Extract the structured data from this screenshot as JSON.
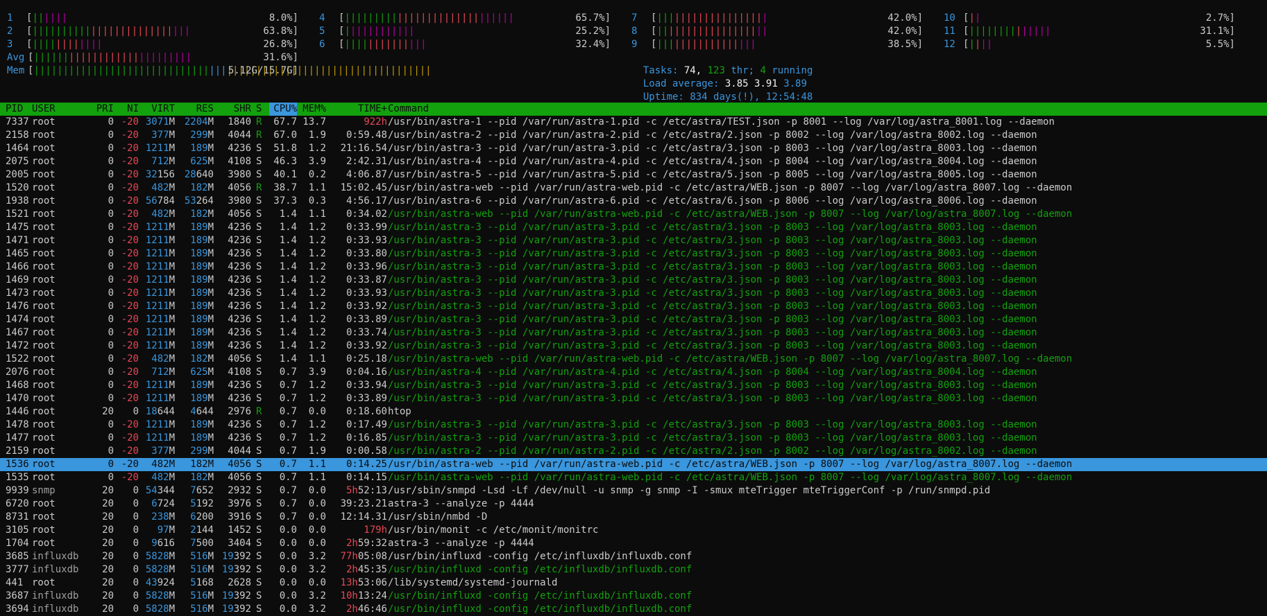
{
  "meters": {
    "left": [
      {
        "label": "1",
        "pct": "8.0%"
      },
      {
        "label": "2",
        "pct": "63.8%"
      },
      {
        "label": "3",
        "pct": "26.8%"
      },
      {
        "label": "Avg",
        "pct": "31.6%"
      },
      {
        "label": "Mem",
        "pct": "5.12G/15.7G"
      }
    ],
    "mid": [
      {
        "label": "4",
        "pct": "65.7%"
      },
      {
        "label": "5",
        "pct": "25.2%"
      },
      {
        "label": "6",
        "pct": "32.4%"
      }
    ],
    "right": [
      {
        "label": "7",
        "pct": "42.0%"
      },
      {
        "label": "8",
        "pct": "42.0%"
      },
      {
        "label": "9",
        "pct": "38.5%"
      }
    ],
    "far": [
      {
        "label": "10",
        "pct": "2.7%"
      },
      {
        "label": "11",
        "pct": "31.1%"
      },
      {
        "label": "12",
        "pct": "5.5%"
      }
    ]
  },
  "tasks": {
    "label": "Tasks:",
    "count": "74,",
    "thr": "123",
    "thr_label": "thr;",
    "running": "4",
    "running_label": "running"
  },
  "load": {
    "label": "Load average:",
    "v1": "3.85",
    "v2": "3.91",
    "v3": "3.89"
  },
  "uptime": {
    "label": "Uptime:",
    "value": "834 days(!), 12:54:48"
  },
  "columns": [
    "PID",
    "USER",
    "PRI",
    "NI",
    "VIRT",
    "RES",
    "SHR",
    "S",
    "CPU%",
    "MEM%",
    "TIME+",
    "Command"
  ],
  "colors": {
    "green": "#13a10e",
    "blue": "#3a96dd",
    "red": "#e74856",
    "magenta": "#b4009e",
    "yellow": "#c19c00"
  },
  "processes": [
    {
      "pid": "7337",
      "user": "root",
      "pri": "0",
      "ni": "-20",
      "virt": "3071M",
      "res": "2204M",
      "shr": "1840",
      "s": "R",
      "cpu": "67.7",
      "mem": "13.7",
      "time": "922h",
      "cmd": "/usr/bin/astra-1 --pid /var/run/astra-1.pid -c /etc/astra/TEST.json -p 8001 --log /var/log/astra_8001.log --daemon",
      "thread": false
    },
    {
      "pid": "2158",
      "user": "root",
      "pri": "0",
      "ni": "-20",
      "virt": "377M",
      "res": "299M",
      "shr": "4044",
      "s": "R",
      "cpu": "67.0",
      "mem": "1.9",
      "time": "0:59.48",
      "cmd": "/usr/bin/astra-2 --pid /var/run/astra-2.pid -c /etc/astra/2.json -p 8002 --log /var/log/astra_8002.log --daemon",
      "thread": false
    },
    {
      "pid": "1464",
      "user": "root",
      "pri": "0",
      "ni": "-20",
      "virt": "1211M",
      "res": "189M",
      "shr": "4236",
      "s": "S",
      "cpu": "51.8",
      "mem": "1.2",
      "time": "21:16.54",
      "cmd": "/usr/bin/astra-3 --pid /var/run/astra-3.pid -c /etc/astra/3.json -p 8003 --log /var/log/astra_8003.log --daemon",
      "thread": false
    },
    {
      "pid": "2075",
      "user": "root",
      "pri": "0",
      "ni": "-20",
      "virt": "712M",
      "res": "625M",
      "shr": "4108",
      "s": "S",
      "cpu": "46.3",
      "mem": "3.9",
      "time": "2:42.31",
      "cmd": "/usr/bin/astra-4 --pid /var/run/astra-4.pid -c /etc/astra/4.json -p 8004 --log /var/log/astra_8004.log --daemon",
      "thread": false
    },
    {
      "pid": "2005",
      "user": "root",
      "pri": "0",
      "ni": "-20",
      "virt": "32156",
      "res": "28640",
      "shr": "3980",
      "s": "S",
      "cpu": "40.1",
      "mem": "0.2",
      "time": "4:06.87",
      "cmd": "/usr/bin/astra-5 --pid /var/run/astra-5.pid -c /etc/astra/5.json -p 8005 --log /var/log/astra_8005.log --daemon",
      "thread": false
    },
    {
      "pid": "1520",
      "user": "root",
      "pri": "0",
      "ni": "-20",
      "virt": "482M",
      "res": "182M",
      "shr": "4056",
      "s": "R",
      "cpu": "38.7",
      "mem": "1.1",
      "time": "15:02.45",
      "cmd": "/usr/bin/astra-web --pid /var/run/astra-web.pid -c /etc/astra/WEB.json -p 8007 --log /var/log/astra_8007.log --daemon",
      "thread": false
    },
    {
      "pid": "1938",
      "user": "root",
      "pri": "0",
      "ni": "-20",
      "virt": "56784",
      "res": "53264",
      "shr": "3980",
      "s": "S",
      "cpu": "37.3",
      "mem": "0.3",
      "time": "4:56.17",
      "cmd": "/usr/bin/astra-6 --pid /var/run/astra-6.pid -c /etc/astra/6.json -p 8006 --log /var/log/astra_8006.log --daemon",
      "thread": false
    },
    {
      "pid": "1521",
      "user": "root",
      "pri": "0",
      "ni": "-20",
      "virt": "482M",
      "res": "182M",
      "shr": "4056",
      "s": "S",
      "cpu": "1.4",
      "mem": "1.1",
      "time": "0:34.02",
      "cmd": "/usr/bin/astra-web --pid /var/run/astra-web.pid -c /etc/astra/WEB.json -p 8007 --log /var/log/astra_8007.log --daemon",
      "thread": true
    },
    {
      "pid": "1475",
      "user": "root",
      "pri": "0",
      "ni": "-20",
      "virt": "1211M",
      "res": "189M",
      "shr": "4236",
      "s": "S",
      "cpu": "1.4",
      "mem": "1.2",
      "time": "0:33.99",
      "cmd": "/usr/bin/astra-3 --pid /var/run/astra-3.pid -c /etc/astra/3.json -p 8003 --log /var/log/astra_8003.log --daemon",
      "thread": true
    },
    {
      "pid": "1471",
      "user": "root",
      "pri": "0",
      "ni": "-20",
      "virt": "1211M",
      "res": "189M",
      "shr": "4236",
      "s": "S",
      "cpu": "1.4",
      "mem": "1.2",
      "time": "0:33.93",
      "cmd": "/usr/bin/astra-3 --pid /var/run/astra-3.pid -c /etc/astra/3.json -p 8003 --log /var/log/astra_8003.log --daemon",
      "thread": true
    },
    {
      "pid": "1465",
      "user": "root",
      "pri": "0",
      "ni": "-20",
      "virt": "1211M",
      "res": "189M",
      "shr": "4236",
      "s": "S",
      "cpu": "1.4",
      "mem": "1.2",
      "time": "0:33.80",
      "cmd": "/usr/bin/astra-3 --pid /var/run/astra-3.pid -c /etc/astra/3.json -p 8003 --log /var/log/astra_8003.log --daemon",
      "thread": true
    },
    {
      "pid": "1466",
      "user": "root",
      "pri": "0",
      "ni": "-20",
      "virt": "1211M",
      "res": "189M",
      "shr": "4236",
      "s": "S",
      "cpu": "1.4",
      "mem": "1.2",
      "time": "0:33.96",
      "cmd": "/usr/bin/astra-3 --pid /var/run/astra-3.pid -c /etc/astra/3.json -p 8003 --log /var/log/astra_8003.log --daemon",
      "thread": true
    },
    {
      "pid": "1469",
      "user": "root",
      "pri": "0",
      "ni": "-20",
      "virt": "1211M",
      "res": "189M",
      "shr": "4236",
      "s": "S",
      "cpu": "1.4",
      "mem": "1.2",
      "time": "0:33.87",
      "cmd": "/usr/bin/astra-3 --pid /var/run/astra-3.pid -c /etc/astra/3.json -p 8003 --log /var/log/astra_8003.log --daemon",
      "thread": true
    },
    {
      "pid": "1473",
      "user": "root",
      "pri": "0",
      "ni": "-20",
      "virt": "1211M",
      "res": "189M",
      "shr": "4236",
      "s": "S",
      "cpu": "1.4",
      "mem": "1.2",
      "time": "0:33.93",
      "cmd": "/usr/bin/astra-3 --pid /var/run/astra-3.pid -c /etc/astra/3.json -p 8003 --log /var/log/astra_8003.log --daemon",
      "thread": true
    },
    {
      "pid": "1476",
      "user": "root",
      "pri": "0",
      "ni": "-20",
      "virt": "1211M",
      "res": "189M",
      "shr": "4236",
      "s": "S",
      "cpu": "1.4",
      "mem": "1.2",
      "time": "0:33.92",
      "cmd": "/usr/bin/astra-3 --pid /var/run/astra-3.pid -c /etc/astra/3.json -p 8003 --log /var/log/astra_8003.log --daemon",
      "thread": true
    },
    {
      "pid": "1474",
      "user": "root",
      "pri": "0",
      "ni": "-20",
      "virt": "1211M",
      "res": "189M",
      "shr": "4236",
      "s": "S",
      "cpu": "1.4",
      "mem": "1.2",
      "time": "0:33.89",
      "cmd": "/usr/bin/astra-3 --pid /var/run/astra-3.pid -c /etc/astra/3.json -p 8003 --log /var/log/astra_8003.log --daemon",
      "thread": true
    },
    {
      "pid": "1467",
      "user": "root",
      "pri": "0",
      "ni": "-20",
      "virt": "1211M",
      "res": "189M",
      "shr": "4236",
      "s": "S",
      "cpu": "1.4",
      "mem": "1.2",
      "time": "0:33.74",
      "cmd": "/usr/bin/astra-3 --pid /var/run/astra-3.pid -c /etc/astra/3.json -p 8003 --log /var/log/astra_8003.log --daemon",
      "thread": true
    },
    {
      "pid": "1472",
      "user": "root",
      "pri": "0",
      "ni": "-20",
      "virt": "1211M",
      "res": "189M",
      "shr": "4236",
      "s": "S",
      "cpu": "1.4",
      "mem": "1.2",
      "time": "0:33.92",
      "cmd": "/usr/bin/astra-3 --pid /var/run/astra-3.pid -c /etc/astra/3.json -p 8003 --log /var/log/astra_8003.log --daemon",
      "thread": true
    },
    {
      "pid": "1522",
      "user": "root",
      "pri": "0",
      "ni": "-20",
      "virt": "482M",
      "res": "182M",
      "shr": "4056",
      "s": "S",
      "cpu": "1.4",
      "mem": "1.1",
      "time": "0:25.18",
      "cmd": "/usr/bin/astra-web --pid /var/run/astra-web.pid -c /etc/astra/WEB.json -p 8007 --log /var/log/astra_8007.log --daemon",
      "thread": true
    },
    {
      "pid": "2076",
      "user": "root",
      "pri": "0",
      "ni": "-20",
      "virt": "712M",
      "res": "625M",
      "shr": "4108",
      "s": "S",
      "cpu": "0.7",
      "mem": "3.9",
      "time": "0:04.16",
      "cmd": "/usr/bin/astra-4 --pid /var/run/astra-4.pid -c /etc/astra/4.json -p 8004 --log /var/log/astra_8004.log --daemon",
      "thread": true
    },
    {
      "pid": "1468",
      "user": "root",
      "pri": "0",
      "ni": "-20",
      "virt": "1211M",
      "res": "189M",
      "shr": "4236",
      "s": "S",
      "cpu": "0.7",
      "mem": "1.2",
      "time": "0:33.94",
      "cmd": "/usr/bin/astra-3 --pid /var/run/astra-3.pid -c /etc/astra/3.json -p 8003 --log /var/log/astra_8003.log --daemon",
      "thread": true
    },
    {
      "pid": "1470",
      "user": "root",
      "pri": "0",
      "ni": "-20",
      "virt": "1211M",
      "res": "189M",
      "shr": "4236",
      "s": "S",
      "cpu": "0.7",
      "mem": "1.2",
      "time": "0:33.89",
      "cmd": "/usr/bin/astra-3 --pid /var/run/astra-3.pid -c /etc/astra/3.json -p 8003 --log /var/log/astra_8003.log --daemon",
      "thread": true
    },
    {
      "pid": "1446",
      "user": "root",
      "pri": "20",
      "ni": "0",
      "virt": "18644",
      "res": "4644",
      "shr": "2976",
      "s": "R",
      "cpu": "0.7",
      "mem": "0.0",
      "time": "0:18.60",
      "cmd": "htop",
      "thread": false
    },
    {
      "pid": "1478",
      "user": "root",
      "pri": "0",
      "ni": "-20",
      "virt": "1211M",
      "res": "189M",
      "shr": "4236",
      "s": "S",
      "cpu": "0.7",
      "mem": "1.2",
      "time": "0:17.49",
      "cmd": "/usr/bin/astra-3 --pid /var/run/astra-3.pid -c /etc/astra/3.json -p 8003 --log /var/log/astra_8003.log --daemon",
      "thread": true
    },
    {
      "pid": "1477",
      "user": "root",
      "pri": "0",
      "ni": "-20",
      "virt": "1211M",
      "res": "189M",
      "shr": "4236",
      "s": "S",
      "cpu": "0.7",
      "mem": "1.2",
      "time": "0:16.85",
      "cmd": "/usr/bin/astra-3 --pid /var/run/astra-3.pid -c /etc/astra/3.json -p 8003 --log /var/log/astra_8003.log --daemon",
      "thread": true
    },
    {
      "pid": "2159",
      "user": "root",
      "pri": "0",
      "ni": "-20",
      "virt": "377M",
      "res": "299M",
      "shr": "4044",
      "s": "S",
      "cpu": "0.7",
      "mem": "1.9",
      "time": "0:00.58",
      "cmd": "/usr/bin/astra-2 --pid /var/run/astra-2.pid -c /etc/astra/2.json -p 8002 --log /var/log/astra_8002.log --daemon",
      "thread": true
    },
    {
      "pid": "1536",
      "user": "root",
      "pri": "0",
      "ni": "-20",
      "virt": "482M",
      "res": "182M",
      "shr": "4056",
      "s": "S",
      "cpu": "0.7",
      "mem": "1.1",
      "time": "0:14.25",
      "cmd": "/usr/bin/astra-web --pid /var/run/astra-web.pid -c /etc/astra/WEB.json -p 8007 --log /var/log/astra_8007.log --daemon",
      "thread": true,
      "selected": true
    },
    {
      "pid": "1535",
      "user": "root",
      "pri": "0",
      "ni": "-20",
      "virt": "482M",
      "res": "182M",
      "shr": "4056",
      "s": "S",
      "cpu": "0.7",
      "mem": "1.1",
      "time": "0:14.15",
      "cmd": "/usr/bin/astra-web --pid /var/run/astra-web.pid -c /etc/astra/WEB.json -p 8007 --log /var/log/astra_8007.log --daemon",
      "thread": true
    },
    {
      "pid": "9939",
      "user": "snmp",
      "pri": "20",
      "ni": "0",
      "virt": "54344",
      "res": "7652",
      "shr": "2932",
      "s": "S",
      "cpu": "0.7",
      "mem": "0.0",
      "time": "5h52:13",
      "cmd": "/usr/sbin/snmpd -Lsd -Lf /dev/null -u snmp -g snmp -I -smux mteTrigger mteTriggerConf -p /run/snmpd.pid",
      "thread": false
    },
    {
      "pid": "6720",
      "user": "root",
      "pri": "20",
      "ni": "0",
      "virt": "6724",
      "res": "5192",
      "shr": "3976",
      "s": "S",
      "cpu": "0.7",
      "mem": "0.0",
      "time": "39:23.21",
      "cmd": "astra-3 --analyze -p 4444",
      "thread": false
    },
    {
      "pid": "8731",
      "user": "root",
      "pri": "20",
      "ni": "0",
      "virt": "238M",
      "res": "6200",
      "shr": "3916",
      "s": "S",
      "cpu": "0.7",
      "mem": "0.0",
      "time": "12:14.31",
      "cmd": "/usr/sbin/nmbd -D",
      "thread": false
    },
    {
      "pid": "3105",
      "user": "root",
      "pri": "20",
      "ni": "0",
      "virt": "97M",
      "res": "2144",
      "shr": "1452",
      "s": "S",
      "cpu": "0.0",
      "mem": "0.0",
      "time": "179h",
      "cmd": "/usr/bin/monit -c /etc/monit/monitrc",
      "thread": false
    },
    {
      "pid": "1704",
      "user": "root",
      "pri": "20",
      "ni": "0",
      "virt": "9616",
      "res": "7500",
      "shr": "3404",
      "s": "S",
      "cpu": "0.0",
      "mem": "0.0",
      "time": "2h59:32",
      "cmd": "astra-3 --analyze -p 4444",
      "thread": false
    },
    {
      "pid": "3685",
      "user": "influxdb",
      "pri": "20",
      "ni": "0",
      "virt": "5828M",
      "res": "516M",
      "shr": "19392",
      "s": "S",
      "cpu": "0.0",
      "mem": "3.2",
      "time": "77h05:08",
      "cmd": "/usr/bin/influxd -config /etc/influxdb/influxdb.conf",
      "thread": false
    },
    {
      "pid": "3777",
      "user": "influxdb",
      "pri": "20",
      "ni": "0",
      "virt": "5828M",
      "res": "516M",
      "shr": "19392",
      "s": "S",
      "cpu": "0.0",
      "mem": "3.2",
      "time": "2h45:35",
      "cmd": "/usr/bin/influxd -config /etc/influxdb/influxdb.conf",
      "thread": true
    },
    {
      "pid": "441",
      "user": "root",
      "pri": "20",
      "ni": "0",
      "virt": "43924",
      "res": "5168",
      "shr": "2628",
      "s": "S",
      "cpu": "0.0",
      "mem": "0.0",
      "time": "13h53:06",
      "cmd": "/lib/systemd/systemd-journald",
      "thread": false
    },
    {
      "pid": "3687",
      "user": "influxdb",
      "pri": "20",
      "ni": "0",
      "virt": "5828M",
      "res": "516M",
      "shr": "19392",
      "s": "S",
      "cpu": "0.0",
      "mem": "3.2",
      "time": "10h13:24",
      "cmd": "/usr/bin/influxd -config /etc/influxdb/influxdb.conf",
      "thread": true
    },
    {
      "pid": "3694",
      "user": "influxdb",
      "pri": "20",
      "ni": "0",
      "virt": "5828M",
      "res": "516M",
      "shr": "19392",
      "s": "S",
      "cpu": "0.0",
      "mem": "3.2",
      "time": "2h46:46",
      "cmd": "/usr/bin/influxd -config /etc/influxdb/influxdb.conf",
      "thread": true
    }
  ]
}
